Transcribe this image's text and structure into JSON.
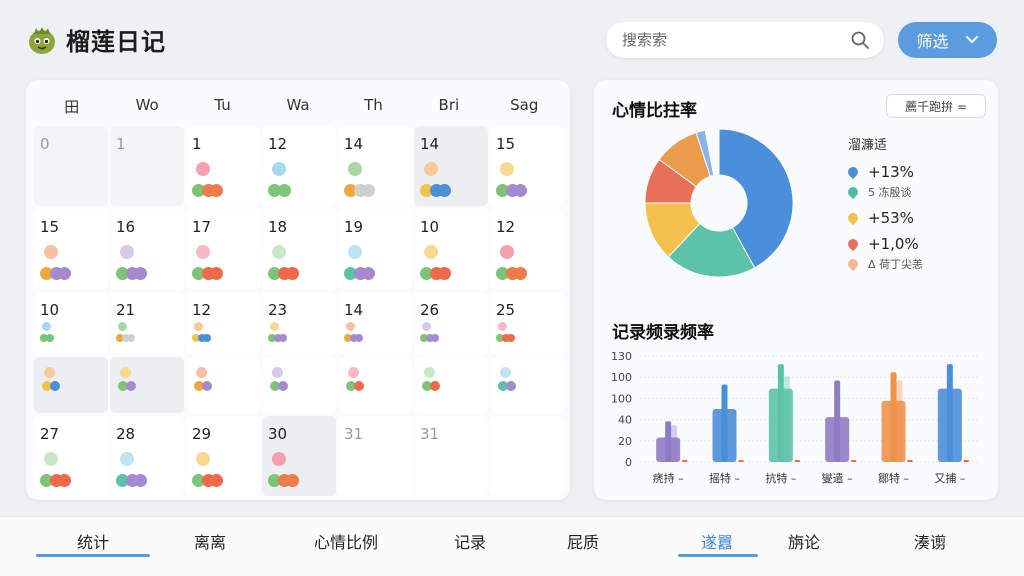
{
  "header": {
    "app_title": "榴莲日记",
    "search_placeholder": "搜索索",
    "filter_label": "筛选"
  },
  "calendar": {
    "weekdays": [
      "田",
      "Wo",
      "Tu",
      "Wa",
      "Th",
      "Bri",
      "Sag"
    ],
    "rows": [
      [
        {
          "n": "0",
          "muted": true
        },
        {
          "n": "1",
          "muted": true
        },
        {
          "n": "1"
        },
        {
          "n": "12"
        },
        {
          "n": "14"
        },
        {
          "n": "14",
          "hl": true
        },
        {
          "n": "15"
        }
      ],
      [
        {
          "n": "15"
        },
        {
          "n": "16"
        },
        {
          "n": "17"
        },
        {
          "n": "18"
        },
        {
          "n": "19"
        },
        {
          "n": "10"
        },
        {
          "n": "12"
        }
      ],
      [
        {
          "n": "10"
        },
        {
          "n": "21"
        },
        {
          "n": "12"
        },
        {
          "n": "23"
        },
        {
          "n": "14"
        },
        {
          "n": "26"
        },
        {
          "n": "25"
        }
      ],
      [
        {
          "n": "27"
        },
        {
          "n": "28"
        },
        {
          "n": "29"
        },
        {
          "n": "30",
          "hl": true
        },
        {
          "n": "31",
          "muted2": true
        },
        {
          "n": "31",
          "muted2": true
        },
        {
          "n": "",
          "empty": true
        }
      ]
    ]
  },
  "mood": {
    "title": "心情比拄率",
    "select_label": "薦千跑拚 ≂",
    "legend_title": "溜濂适",
    "legend": [
      {
        "value": "+13%",
        "color": "#4a8fd9",
        "sub": "5 冻殷谈"
      },
      {
        "value": "+53%",
        "color": "#f2c14e",
        "sub": ""
      },
      {
        "value": "+1,0%",
        "color": "#e8705a",
        "sub": "Δ 荷丁尖恙"
      }
    ],
    "legend_sub_first_color": "#4dbfa8",
    "legend_last_color": "#f5b895",
    "pie_colors": [
      "#4a8fd9",
      "#5cc3a9",
      "#f2c14e",
      "#e8705a",
      "#ec9a4c",
      "#8ab4e8"
    ]
  },
  "frequency": {
    "title": "记录频录频率"
  },
  "chart_data": {
    "type": "bar",
    "categories": [
      "痜持 –",
      "摇特 –",
      "抗特 –",
      "燮遣 –",
      "鄒特 –",
      "又捕 –"
    ],
    "series": [
      {
        "values": [
          30,
          65,
          90,
          55,
          75,
          90
        ]
      },
      {
        "values": [
          50,
          95,
          120,
          100,
          110,
          120
        ]
      },
      {
        "values": [
          45,
          0,
          105,
          0,
          100,
          0
        ]
      }
    ],
    "colors": [
      "#8f7bc4",
      "#4a8fd9",
      "#5cc3a9",
      "#8f7bc4",
      "#f0914a",
      "#4a8fd9"
    ],
    "ylim": [
      0,
      130
    ],
    "yticks": [
      "130",
      "100",
      "100",
      "40",
      "20",
      "0"
    ]
  },
  "nav": {
    "items": [
      "统计",
      "离离",
      "心情比例",
      "记录",
      "屁质",
      "遂囂",
      "旃论",
      "湊谫"
    ]
  }
}
